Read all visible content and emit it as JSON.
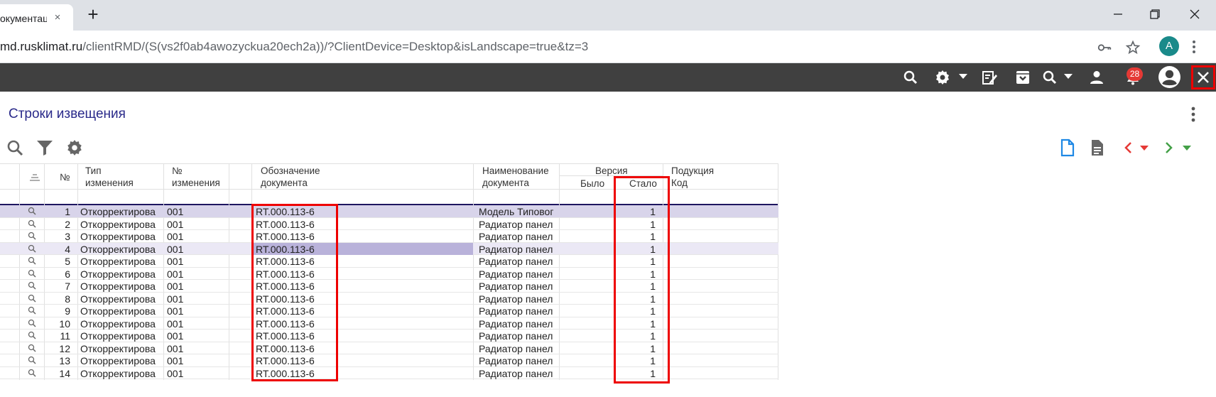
{
  "browser": {
    "tab_title": "окументац",
    "tab_close": "×",
    "new_tab": "+",
    "url_host": "md.rusklimat.ru",
    "url_path": "/clientRMD/(S(vs2f0ab4awozyckua20ech2a))/?ClientDevice=Desktop&isLandscape=true&tz=3",
    "profile_initial": "A",
    "icons": [
      "minimize-icon",
      "restore-icon",
      "close-icon",
      "key-icon",
      "star-icon",
      "kebab-icon"
    ]
  },
  "appbar": {
    "notifications_count": "28",
    "icons": [
      "search-icon",
      "gear-icon",
      "edit-note-icon",
      "archive-icon",
      "search-icon",
      "person-icon",
      "bell-icon",
      "account-circle-icon",
      "close-icon"
    ]
  },
  "page": {
    "title": "Строки извещения"
  },
  "table": {
    "headers": {
      "num": "№",
      "type_line1": "Тип",
      "type_line2": "изменения",
      "change_line1": "№",
      "change_line2": "изменения",
      "doc_line1": "Обозначение",
      "doc_line2": "документа",
      "name_line1": "Наименование",
      "name_line2": "документа",
      "version": "Версия",
      "was": "Было",
      "became": "Стало",
      "product_line1": "Подукция",
      "product_line2": "Код"
    },
    "rows": [
      {
        "num": "1",
        "type": "Откорректирова",
        "change": "001",
        "doc": "RT.000.113-6",
        "name": "Модель Типовог",
        "became": "1"
      },
      {
        "num": "2",
        "type": "Откорректирова",
        "change": "001",
        "doc": "RT.000.113-6",
        "name": "Радиатор панел",
        "became": "1"
      },
      {
        "num": "3",
        "type": "Откорректирова",
        "change": "001",
        "doc": "RT.000.113-6",
        "name": "Радиатор панел",
        "became": "1"
      },
      {
        "num": "4",
        "type": "Откорректирова",
        "change": "001",
        "doc": "RT.000.113-6",
        "name": "Радиатор панел",
        "became": "1"
      },
      {
        "num": "5",
        "type": "Откорректирова",
        "change": "001",
        "doc": "RT.000.113-6",
        "name": "Радиатор панел",
        "became": "1"
      },
      {
        "num": "6",
        "type": "Откорректирова",
        "change": "001",
        "doc": "RT.000.113-6",
        "name": "Радиатор панел",
        "became": "1"
      },
      {
        "num": "7",
        "type": "Откорректирова",
        "change": "001",
        "doc": "RT.000.113-6",
        "name": "Радиатор панел",
        "became": "1"
      },
      {
        "num": "8",
        "type": "Откорректирова",
        "change": "001",
        "doc": "RT.000.113-6",
        "name": "Радиатор панел",
        "became": "1"
      },
      {
        "num": "9",
        "type": "Откорректирова",
        "change": "001",
        "doc": "RT.000.113-6",
        "name": "Радиатор панел",
        "became": "1"
      },
      {
        "num": "10",
        "type": "Откорректирова",
        "change": "001",
        "doc": "RT.000.113-6",
        "name": "Радиатор панел",
        "became": "1"
      },
      {
        "num": "11",
        "type": "Откорректирова",
        "change": "001",
        "doc": "RT.000.113-6",
        "name": "Радиатор панел",
        "became": "1"
      },
      {
        "num": "12",
        "type": "Откорректирова",
        "change": "001",
        "doc": "RT.000.113-6",
        "name": "Радиатор панел",
        "became": "1"
      },
      {
        "num": "13",
        "type": "Откорректирова",
        "change": "001",
        "doc": "RT.000.113-6",
        "name": "Радиатор панел",
        "became": "1"
      },
      {
        "num": "14",
        "type": "Откорректирова",
        "change": "001",
        "doc": "RT.000.113-6",
        "name": "Радиатор панел",
        "became": "1"
      }
    ]
  },
  "colors": {
    "accent_title": "#2a2a8a",
    "selected_row": "#d8d4ea",
    "annotation_red": "#e00",
    "nav_prev": "#e53935",
    "nav_next": "#43a047",
    "doc_blue": "#1e88e5"
  }
}
